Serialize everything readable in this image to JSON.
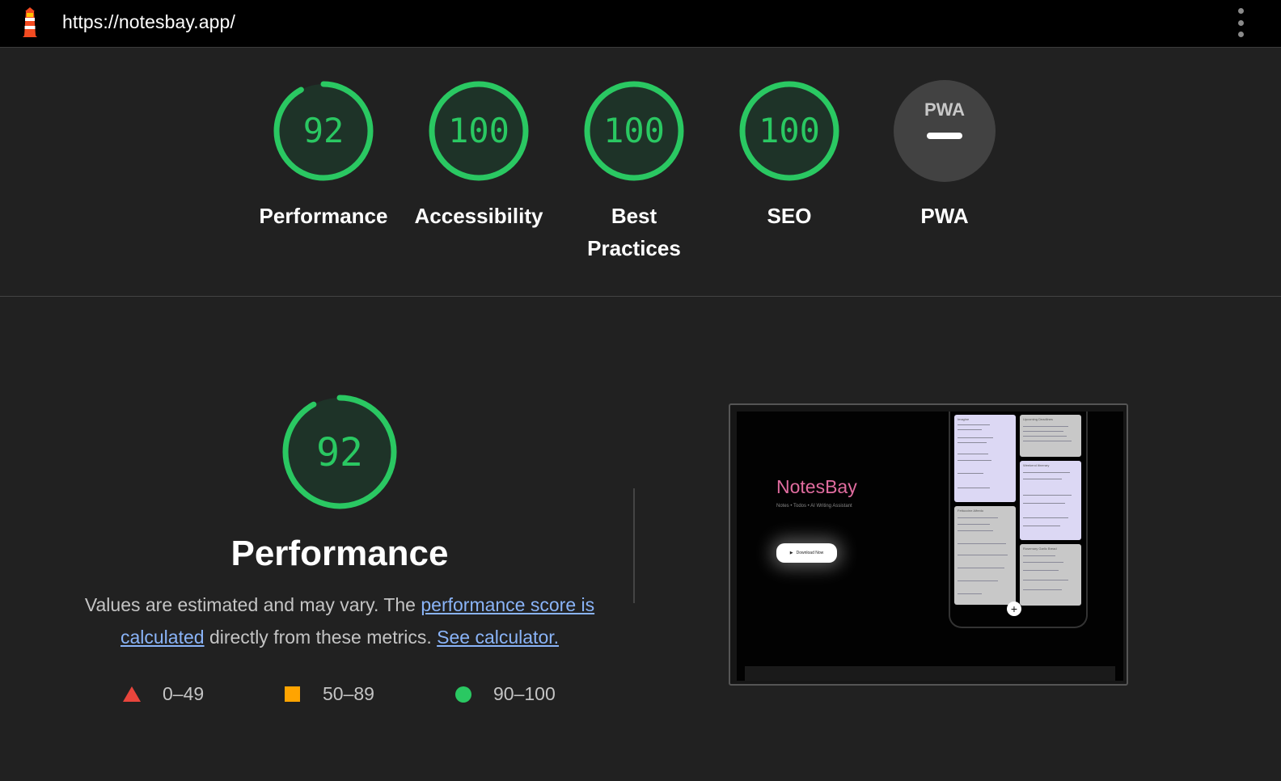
{
  "topbar": {
    "url": "https://notesbay.app/",
    "logo_icon": "lighthouse-icon",
    "menu_icon": "kebab-menu-icon"
  },
  "colors": {
    "pass": "#2ac862",
    "pass_bg": "#1e3328",
    "average": "#ffa400",
    "fail": "#e8453c",
    "link": "#8ab4f8"
  },
  "categories": [
    {
      "label": "Performance",
      "score": "92",
      "fraction": 0.92
    },
    {
      "label": "Accessibility",
      "score": "100",
      "fraction": 1.0
    },
    {
      "label": "Best Practices",
      "score": "100",
      "fraction": 1.0
    },
    {
      "label": "SEO",
      "score": "100",
      "fraction": 1.0
    },
    {
      "label": "PWA",
      "badge_text": "PWA",
      "icon": "pwa-dash-icon"
    }
  ],
  "performance": {
    "score": "92",
    "fraction": 0.92,
    "title": "Performance",
    "desc_part1": "Values are estimated and may vary. The ",
    "link_score": "performance score is calculated",
    "desc_part2": " directly from these metrics. ",
    "link_calc": "See calculator.",
    "legend": [
      {
        "shape": "triangle",
        "range": "0–49"
      },
      {
        "shape": "square",
        "range": "50–89"
      },
      {
        "shape": "circle",
        "range": "90–100"
      }
    ]
  },
  "screenshot": {
    "app_name": "NotesBay",
    "tagline": "Notes • Todos • AI Writing Assistant",
    "download_label": "Download Now",
    "add_icon": "plus-icon",
    "notes": [
      "Imagine",
      "Upcoming Deadlines",
      "Weekend Itinerary",
      "Fettuccine Alfredo",
      "Rosemary Garlic Bread"
    ]
  }
}
